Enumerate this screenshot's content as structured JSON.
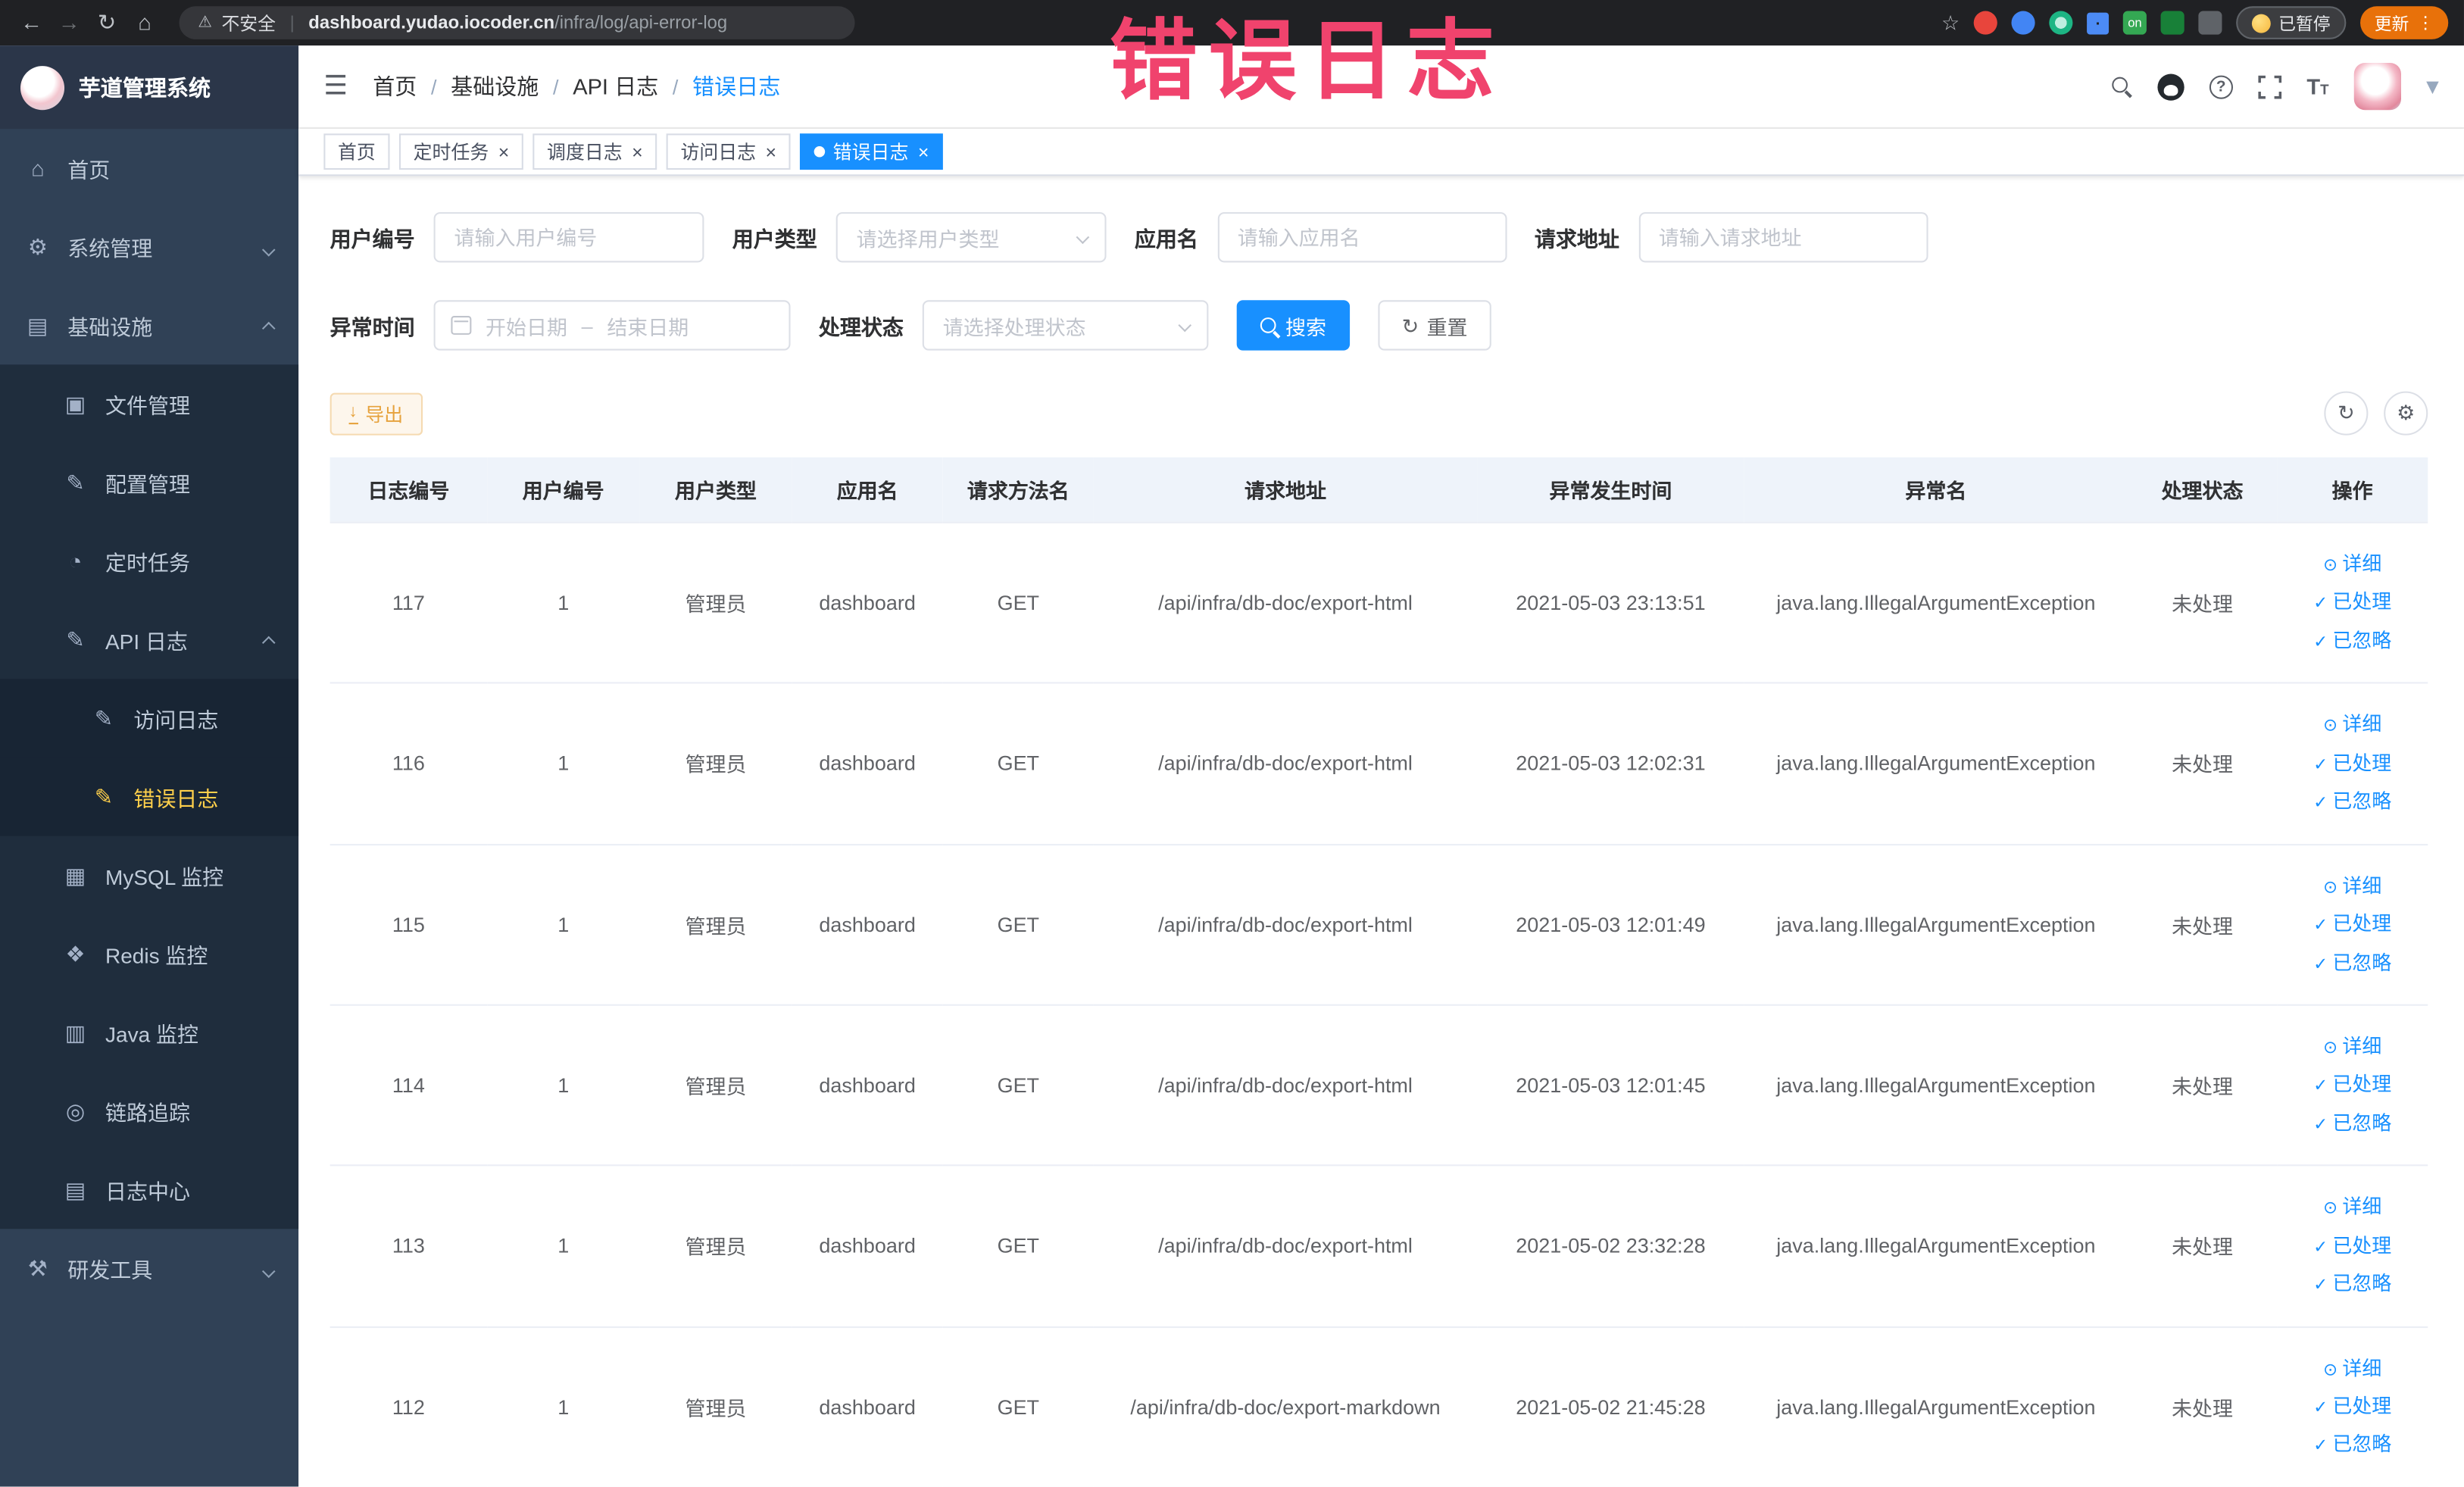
{
  "icons": {
    "back": "←",
    "forward": "→",
    "reload": "↻",
    "home": "⌂",
    "warning": "⚠",
    "star": "☆",
    "dots": "⋮",
    "hamburger": "☰",
    "close": "×",
    "check": "✓",
    "eye": "⊙",
    "refresh": "↻",
    "gear": "⚙",
    "download": "↓",
    "question": "?",
    "on_badge": "on",
    "caret": "▾"
  },
  "browser": {
    "security_label": "不安全",
    "url_host": "dashboard.yudao.iocoder.cn",
    "url_path": "/infra/log/api-error-log",
    "paused_badge": "已暂停",
    "update_button": "更新"
  },
  "annotation": {
    "text": "错误日志"
  },
  "sidebar": {
    "logo_title": "芋道管理系统",
    "items": [
      {
        "label": "首页",
        "icon": "⌂"
      },
      {
        "label": "系统管理",
        "icon": "⚙"
      },
      {
        "label": "基础设施",
        "icon": "▤"
      },
      {
        "label": "文件管理",
        "icon": "▣"
      },
      {
        "label": "配置管理",
        "icon": "✎"
      },
      {
        "label": "定时任务",
        "icon": "◔"
      },
      {
        "label": "API 日志",
        "icon": "✎"
      },
      {
        "label": "访问日志",
        "icon": "✎"
      },
      {
        "label": "错误日志",
        "icon": "✎"
      },
      {
        "label": "MySQL 监控",
        "icon": "▦"
      },
      {
        "label": "Redis 监控",
        "icon": "❖"
      },
      {
        "label": "Java 监控",
        "icon": "▥"
      },
      {
        "label": "链路追踪",
        "icon": "◎"
      },
      {
        "label": "日志中心",
        "icon": "▤"
      },
      {
        "label": "研发工具",
        "icon": "⚒"
      }
    ]
  },
  "header": {
    "breadcrumb": [
      "首页",
      "基础设施",
      "API 日志",
      "错误日志"
    ]
  },
  "tabs": [
    {
      "label": "首页"
    },
    {
      "label": "定时任务"
    },
    {
      "label": "调度日志"
    },
    {
      "label": "访问日志"
    },
    {
      "label": "错误日志"
    }
  ],
  "filters": {
    "user_id": {
      "label": "用户编号",
      "placeholder": "请输入用户编号"
    },
    "user_type": {
      "label": "用户类型",
      "placeholder": "请选择用户类型"
    },
    "app_name": {
      "label": "应用名",
      "placeholder": "请输入应用名"
    },
    "request_url": {
      "label": "请求地址",
      "placeholder": "请输入请求地址"
    },
    "exception_time": {
      "label": "异常时间",
      "start_placeholder": "开始日期",
      "end_placeholder": "结束日期",
      "separator": "–"
    },
    "process_status": {
      "label": "处理状态",
      "placeholder": "请选择处理状态"
    },
    "search_button": "搜索",
    "reset_button": "重置"
  },
  "toolbar": {
    "export_button": "导出"
  },
  "table": {
    "columns": [
      "日志编号",
      "用户编号",
      "用户类型",
      "应用名",
      "请求方法名",
      "请求地址",
      "异常发生时间",
      "异常名",
      "处理状态",
      "操作"
    ],
    "actions": [
      "详细",
      "已处理",
      "已忽略"
    ],
    "rows": [
      {
        "log_id": "117",
        "user_id": "1",
        "user_type": "管理员",
        "app": "dashboard",
        "method": "GET",
        "url": "/api/infra/db-doc/export-html",
        "time": "2021-05-03 23:13:51",
        "exception": "java.lang.IllegalArgumentException",
        "status": "未处理"
      },
      {
        "log_id": "116",
        "user_id": "1",
        "user_type": "管理员",
        "app": "dashboard",
        "method": "GET",
        "url": "/api/infra/db-doc/export-html",
        "time": "2021-05-03 12:02:31",
        "exception": "java.lang.IllegalArgumentException",
        "status": "未处理"
      },
      {
        "log_id": "115",
        "user_id": "1",
        "user_type": "管理员",
        "app": "dashboard",
        "method": "GET",
        "url": "/api/infra/db-doc/export-html",
        "time": "2021-05-03 12:01:49",
        "exception": "java.lang.IllegalArgumentException",
        "status": "未处理"
      },
      {
        "log_id": "114",
        "user_id": "1",
        "user_type": "管理员",
        "app": "dashboard",
        "method": "GET",
        "url": "/api/infra/db-doc/export-html",
        "time": "2021-05-03 12:01:45",
        "exception": "java.lang.IllegalArgumentException",
        "status": "未处理"
      },
      {
        "log_id": "113",
        "user_id": "1",
        "user_type": "管理员",
        "app": "dashboard",
        "method": "GET",
        "url": "/api/infra/db-doc/export-html",
        "time": "2021-05-02 23:32:28",
        "exception": "java.lang.IllegalArgumentException",
        "status": "未处理"
      },
      {
        "log_id": "112",
        "user_id": "1",
        "user_type": "管理员",
        "app": "dashboard",
        "method": "GET",
        "url": "/api/infra/db-doc/export-markdown",
        "time": "2021-05-02 21:45:28",
        "exception": "java.lang.IllegalArgumentException",
        "status": "未处理"
      }
    ]
  }
}
